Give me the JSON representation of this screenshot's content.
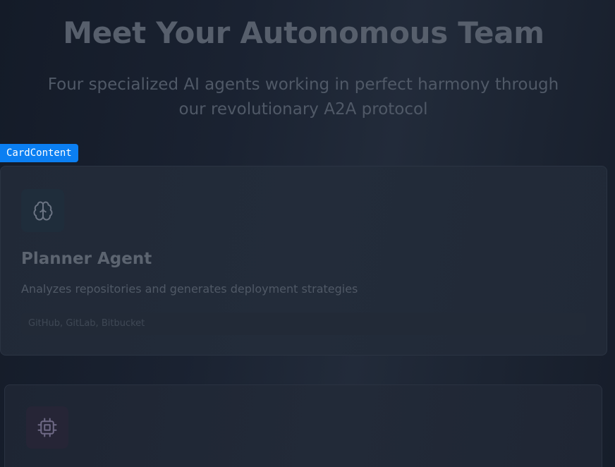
{
  "header": {
    "title": "Meet Your Autonomous Team",
    "subtitle": "Four specialized AI agents working in perfect harmony through our revolutionary A2A protocol"
  },
  "debug_tag": "CardContent",
  "agents": [
    {
      "name": "Planner Agent",
      "description": "Analyzes repositories and generates deployment strategies",
      "meta": "GitHub, GitLab, Bitbucket",
      "icon": "brain-icon"
    },
    {
      "icon": "cpu-icon"
    }
  ]
}
